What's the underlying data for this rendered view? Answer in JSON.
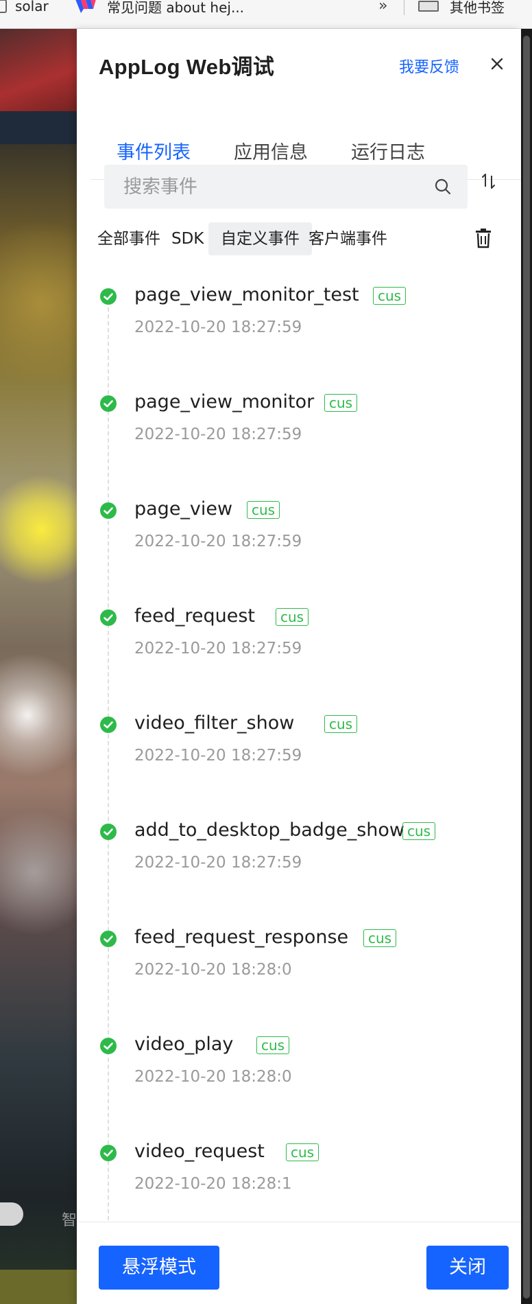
{
  "browser": {
    "bookmarks": [
      {
        "label": "solar",
        "icon": "bookmark-page-icon"
      },
      {
        "label": "常见问题 about hej...",
        "icon": "site-logo-icon"
      },
      {
        "label": "»",
        "icon": "chevron-double-right-icon"
      },
      {
        "label": "其他书签",
        "icon": "folder-icon"
      }
    ]
  },
  "background_page": {
    "bottom_text": "智"
  },
  "panel": {
    "title": "AppLog Web调试",
    "feedback_label": "我要反馈",
    "close_icon": "close-icon",
    "tabs": [
      {
        "label": "事件列表",
        "active": true
      },
      {
        "label": "应用信息",
        "active": false
      },
      {
        "label": "运行日志",
        "active": false
      }
    ],
    "search": {
      "placeholder": "搜索事件",
      "value": ""
    },
    "sort_icon": "sort-icon",
    "filters": [
      {
        "label": "全部事件",
        "selected": false
      },
      {
        "label": "SDK",
        "selected": false
      },
      {
        "label": "自定义事件",
        "selected": true
      },
      {
        "label": "客户端事件",
        "selected": false
      }
    ],
    "clear_icon": "trash-icon",
    "events": [
      {
        "name": "page_view_monitor_test",
        "tag": "cus",
        "time": "2022-10-20 18:27:59",
        "status": "success"
      },
      {
        "name": "page_view_monitor",
        "tag": "cus",
        "time": "2022-10-20 18:27:59",
        "status": "success"
      },
      {
        "name": "page_view",
        "tag": "cus",
        "time": "2022-10-20 18:27:59",
        "status": "success"
      },
      {
        "name": "feed_request",
        "tag": "cus",
        "time": "2022-10-20 18:27:59",
        "status": "success"
      },
      {
        "name": "video_filter_show",
        "tag": "cus",
        "time": "2022-10-20 18:27:59",
        "status": "success"
      },
      {
        "name": "add_to_desktop_badge_show",
        "tag": "cus",
        "time": "2022-10-20 18:27:59",
        "status": "success"
      },
      {
        "name": "feed_request_response",
        "tag": "cus",
        "time": "2022-10-20 18:28:0",
        "status": "success"
      },
      {
        "name": "video_play",
        "tag": "cus",
        "time": "2022-10-20 18:28:0",
        "status": "success"
      },
      {
        "name": "video_request",
        "tag": "cus",
        "time": "2022-10-20 18:28:1",
        "status": "success"
      }
    ],
    "footer": {
      "float_mode_label": "悬浮模式",
      "close_label": "关闭"
    },
    "colors": {
      "accent": "#1664ff",
      "success": "#2eba4a",
      "muted_text": "#9a9a9a"
    }
  }
}
